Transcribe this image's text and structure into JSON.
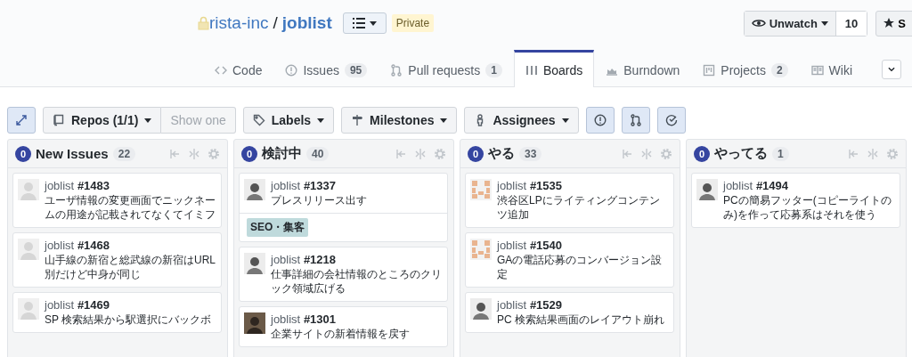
{
  "repo": {
    "owner": "rista-inc",
    "separator": "/",
    "name": "joblist",
    "badge": "Private"
  },
  "watch": {
    "label": "Unwatch",
    "count": "10"
  },
  "star": {
    "label": "S"
  },
  "tabs": [
    {
      "label": "Code",
      "selected": false
    },
    {
      "label": "Issues",
      "count": "95",
      "selected": false
    },
    {
      "label": "Pull requests",
      "count": "1",
      "selected": false
    },
    {
      "label": "Boards",
      "selected": true
    },
    {
      "label": "Burndown",
      "selected": false
    },
    {
      "label": "Projects",
      "count": "2",
      "selected": false
    },
    {
      "label": "Wiki",
      "selected": false
    }
  ],
  "toolbar": {
    "repos": {
      "label": "Repos (1/1)",
      "show_one": "Show one",
      "show_one_disabled": true
    },
    "filters": [
      "Labels",
      "Milestones",
      "Assignees"
    ],
    "toggles": [
      {
        "active": true
      },
      {
        "active": true
      },
      {
        "active": true
      }
    ]
  },
  "columns": [
    {
      "badge": "0",
      "name": "New Issues",
      "count": "22",
      "cards": [
        {
          "kind": "blank",
          "repo": "joblist",
          "number": "#1483",
          "title": "ユーザ情報の変更画面でニックネームの用途が記載されてなくてイミフ"
        },
        {
          "kind": "blank",
          "repo": "joblist",
          "number": "#1468",
          "title": "山手線の新宿と総武線の新宿はURL別だけど中身が同じ"
        },
        {
          "kind": "blank",
          "repo": "joblist",
          "number": "#1469",
          "title": "SP 検索結果から駅選択にバックボ"
        }
      ]
    },
    {
      "badge": "0",
      "name": "検討中",
      "count": "40",
      "cards": [
        {
          "kind": "photo",
          "repo": "joblist",
          "number": "#1337",
          "title": "プレスリリース出す",
          "labels": [
            {
              "text": "SEO・集客",
              "color": "#bfdadc"
            }
          ]
        },
        {
          "kind": "photo",
          "repo": "joblist",
          "number": "#1218",
          "title": "仕事詳細の会社情報のところのクリック領域広げる"
        },
        {
          "kind": "dark",
          "repo": "joblist",
          "number": "#1301",
          "title": "企業サイトの新着情報を戻す"
        }
      ]
    },
    {
      "badge": "0",
      "name": "やる",
      "count": "33",
      "cards": [
        {
          "kind": "identicon",
          "repo": "joblist",
          "number": "#1535",
          "title": "渋谷区LPにライティングコンテンツ追加"
        },
        {
          "kind": "identicon",
          "repo": "joblist",
          "number": "#1540",
          "title": "GAの電話応募のコンバージョン設定"
        },
        {
          "kind": "photo",
          "repo": "joblist",
          "number": "#1529",
          "title": "PC 検索結果画面のレイアウト崩れ"
        }
      ]
    },
    {
      "badge": "0",
      "name": "やってる",
      "count": "1",
      "cards": [
        {
          "kind": "photo",
          "repo": "joblist",
          "number": "#1494",
          "title": "PCの簡易フッター(コピーライトのみ)を作って応募系はそれを使う"
        }
      ]
    }
  ]
}
